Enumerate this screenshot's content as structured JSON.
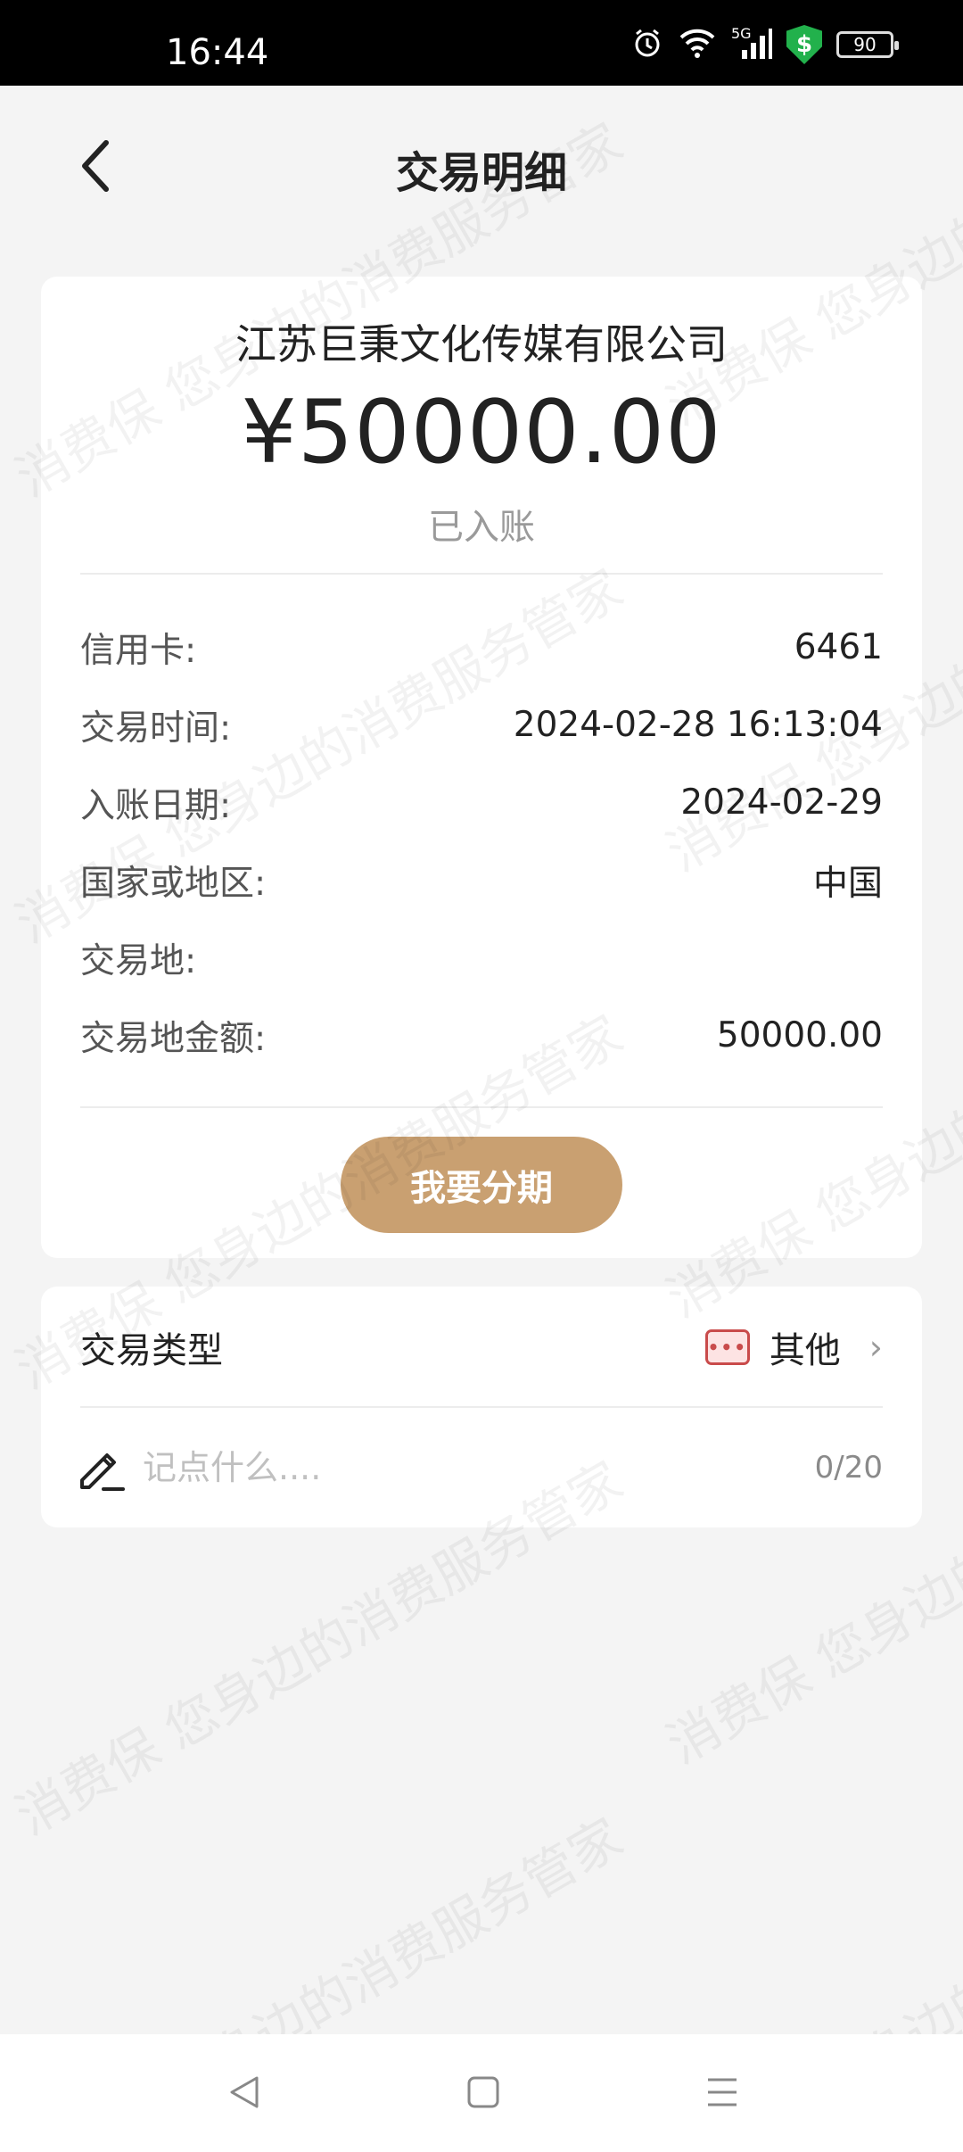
{
  "status_bar": {
    "time": "16:44",
    "icons": [
      "alarm-icon",
      "wifi-icon",
      "signal-5g-icon",
      "security-shield-icon"
    ],
    "network": "5G",
    "shield_symbol": "$",
    "battery": "90"
  },
  "header": {
    "title": "交易明细",
    "back_icon": "chevron-left-icon"
  },
  "transaction": {
    "merchant": "江苏巨秉文化传媒有限公司",
    "amount": "¥50000.00",
    "status": "已入账",
    "details": [
      {
        "label": "信用卡:",
        "value": "6461"
      },
      {
        "label": "交易时间:",
        "value": "2024-02-28 16:13:04"
      },
      {
        "label": "入账日期:",
        "value": "2024-02-29"
      },
      {
        "label": "国家或地区:",
        "value": "中国"
      },
      {
        "label": "交易地:",
        "value": ""
      },
      {
        "label": "交易地金额:",
        "value": "50000.00"
      }
    ],
    "installment_button": "我要分期"
  },
  "transaction_type": {
    "label": "交易类型",
    "icon": "more-dots-icon",
    "icon_glyph": "•••",
    "value": "其他",
    "chevron": "›"
  },
  "note": {
    "placeholder": "记点什么....",
    "value": "",
    "count": "0/20",
    "icon": "pencil-icon"
  },
  "watermark": {
    "text": "消费保  您身边的消费服务管家"
  },
  "nav_bar": {
    "icons": [
      "nav-back-icon",
      "nav-home-icon",
      "nav-menu-icon"
    ]
  },
  "colors": {
    "accent": "#c9a071",
    "background": "#f4f4f4",
    "type_icon": "#c94b4b"
  }
}
